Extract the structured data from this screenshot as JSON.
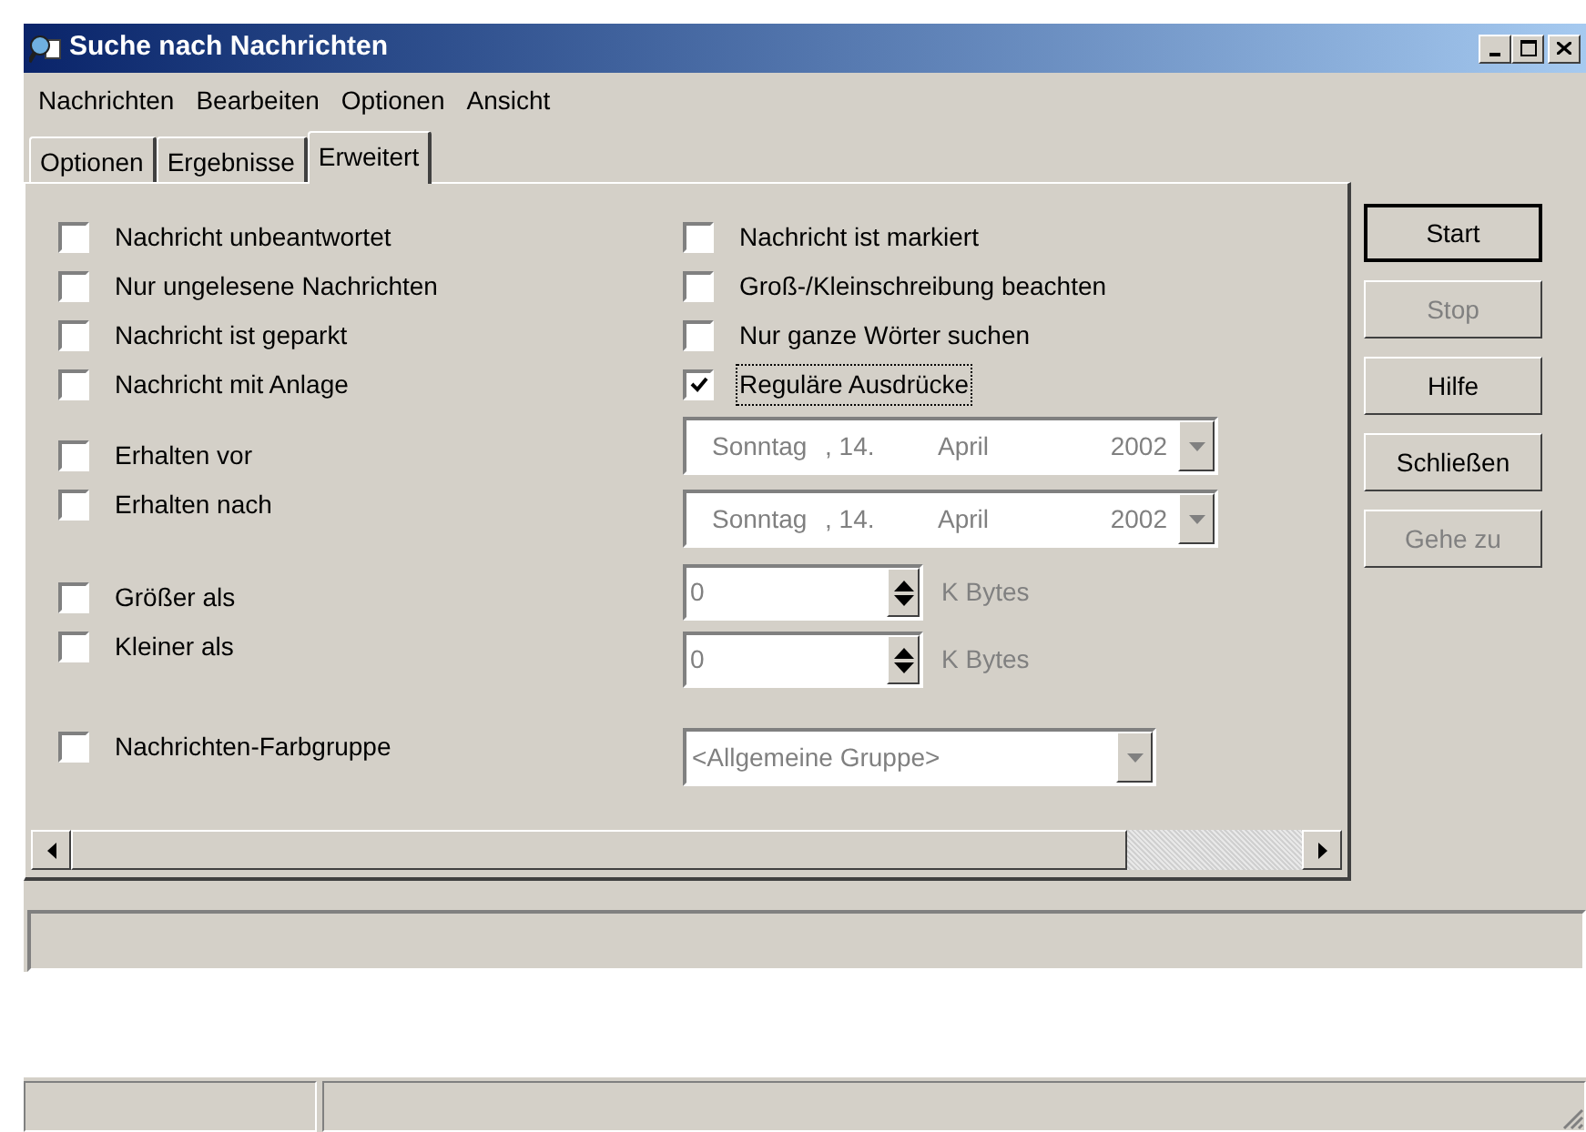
{
  "window": {
    "title": "Suche nach Nachrichten"
  },
  "menu": [
    "Nachrichten",
    "Bearbeiten",
    "Optionen",
    "Ansicht"
  ],
  "tabs": [
    {
      "label": "Optionen",
      "selected": false
    },
    {
      "label": "Ergebnisse",
      "selected": false
    },
    {
      "label": "Erweitert",
      "selected": true
    }
  ],
  "flags_left": [
    {
      "label": "Nachricht unbeantwortet",
      "checked": false,
      "focused": false
    },
    {
      "label": "Nur ungelesene Nachrichten",
      "checked": false,
      "focused": false
    },
    {
      "label": "Nachricht ist geparkt",
      "checked": false,
      "focused": false
    },
    {
      "label": "Nachricht mit Anlage",
      "checked": false,
      "focused": false
    }
  ],
  "flags_right": [
    {
      "label": "Nachricht ist markiert",
      "checked": false,
      "focused": false
    },
    {
      "label": "Groß-/Kleinschreibung beachten",
      "checked": false,
      "focused": false
    },
    {
      "label": "Nur ganze Wörter suchen",
      "checked": false,
      "focused": false
    },
    {
      "label": "Reguläre Ausdrücke",
      "checked": true,
      "focused": true
    }
  ],
  "date_filters": [
    {
      "label": "Erhalten vor",
      "checked": false,
      "disabled": true,
      "weekday": "Sonntag",
      "day": ", 14.",
      "month": "April",
      "year": "2002"
    },
    {
      "label": "Erhalten nach",
      "checked": false,
      "disabled": true,
      "weekday": "Sonntag",
      "day": ", 14.",
      "month": "April",
      "year": "2002"
    }
  ],
  "size_filters": [
    {
      "label": "Größer als",
      "checked": false,
      "disabled": true,
      "value": "0",
      "unit": "K Bytes"
    },
    {
      "label": "Kleiner als",
      "checked": false,
      "disabled": true,
      "value": "0",
      "unit": "K Bytes"
    }
  ],
  "color_group": {
    "label": "Nachrichten-Farbgruppe",
    "checked": false,
    "disabled": true,
    "value": "<Allgemeine Gruppe>"
  },
  "buttons": [
    {
      "label": "Start",
      "disabled": false,
      "default": true
    },
    {
      "label": "Stop",
      "disabled": true,
      "default": false
    },
    {
      "label": "Hilfe",
      "disabled": false,
      "default": false
    },
    {
      "label": "Schließen",
      "disabled": false,
      "default": false
    },
    {
      "label": "Gehe zu",
      "disabled": true,
      "default": false
    }
  ]
}
